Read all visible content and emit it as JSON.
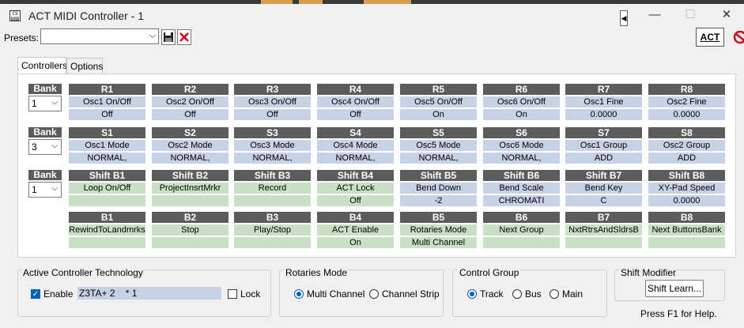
{
  "window": {
    "app_icon_text": "CS\nBBB",
    "title": "ACT MIDI Controller - 1",
    "arrow": "◀",
    "minimize": "—",
    "maximize": "☐",
    "close": "✕"
  },
  "presets": {
    "label": "Presets:",
    "value": "",
    "chevron": "⌵",
    "save_icon": "floppy-disk-icon",
    "delete_icon": "red-x-icon",
    "act_label": "ACT"
  },
  "tabs": [
    {
      "label": "Controllers",
      "active": true
    },
    {
      "label": "Options",
      "active": false
    }
  ],
  "bank_label": "Bank",
  "rows": [
    {
      "bank": "1",
      "kind": "blue",
      "cells": [
        {
          "head": "R1",
          "name": "Osc1 On/Off",
          "value": "Off"
        },
        {
          "head": "R2",
          "name": "Osc2 On/Off",
          "value": "Off"
        },
        {
          "head": "R3",
          "name": "Osc3 On/Off",
          "value": "Off"
        },
        {
          "head": "R4",
          "name": "Osc4 On/Off",
          "value": "Off"
        },
        {
          "head": "R5",
          "name": "Osc5 On/Off",
          "value": "On"
        },
        {
          "head": "R6",
          "name": "Osc6 On/Off",
          "value": "On"
        },
        {
          "head": "R7",
          "name": "Osc1 Fine",
          "value": "0.0000"
        },
        {
          "head": "R8",
          "name": "Osc2 Fine",
          "value": "0.0000"
        }
      ]
    },
    {
      "bank": "3",
      "kind": "blue",
      "cells": [
        {
          "head": "S1",
          "name": "Osc1 Mode",
          "value": "NORMAL,"
        },
        {
          "head": "S2",
          "name": "Osc2 Mode",
          "value": "NORMAL,"
        },
        {
          "head": "S3",
          "name": "Osc3 Mode",
          "value": "NORMAL,"
        },
        {
          "head": "S4",
          "name": "Osc4 Mode",
          "value": "NORMAL,"
        },
        {
          "head": "S5",
          "name": "Osc5 Mode",
          "value": "NORMAL,"
        },
        {
          "head": "S6",
          "name": "Osc6 Mode",
          "value": "NORMAL,"
        },
        {
          "head": "S7",
          "name": "Osc1 Group",
          "value": "ADD"
        },
        {
          "head": "S8",
          "name": "Osc2 Group",
          "value": "ADD"
        }
      ]
    },
    {
      "bank": "1",
      "kind": "mixed",
      "cells": [
        {
          "head": "Shift B1",
          "name": "Loop On/Off",
          "value": "",
          "color": "green"
        },
        {
          "head": "Shift B2",
          "name": "ProjectInsrtMrkr",
          "value": "",
          "color": "green"
        },
        {
          "head": "Shift B3",
          "name": "Record",
          "value": "",
          "color": "green"
        },
        {
          "head": "Shift B4",
          "name": "ACT Lock",
          "value": "Off",
          "color": "green"
        },
        {
          "head": "Shift B5",
          "name": "Bend Down",
          "value": "-2",
          "color": "blue"
        },
        {
          "head": "Shift B6",
          "name": "Bend Scale",
          "value": "CHROMATI",
          "color": "blue"
        },
        {
          "head": "Shift B7",
          "name": "Bend Key",
          "value": "C",
          "color": "blue"
        },
        {
          "head": "Shift B8",
          "name": "XY-Pad Speed",
          "value": "0.0000",
          "color": "blue"
        }
      ]
    },
    {
      "bank": null,
      "kind": "green",
      "cells": [
        {
          "head": "B1",
          "name": "RewindToLandmrks",
          "value": ""
        },
        {
          "head": "B2",
          "name": "Stop",
          "value": ""
        },
        {
          "head": "B3",
          "name": "Play/Stop",
          "value": ""
        },
        {
          "head": "B4",
          "name": "ACT Enable",
          "value": "On"
        },
        {
          "head": "B5",
          "name": "Rotaries Mode",
          "value": "Multi Channel"
        },
        {
          "head": "B6",
          "name": "Next Group",
          "value": ""
        },
        {
          "head": "B7",
          "name": "NxtRtrsAndSldrsB",
          "value": ""
        },
        {
          "head": "B8",
          "name": "Next ButtonsBank",
          "value": ""
        }
      ]
    }
  ],
  "act_group": {
    "title": "Active Controller Technology",
    "enable_label": "Enable",
    "enable_checked": true,
    "tech_value": "Z3TA+ 2    * 1",
    "lock_label": "Lock",
    "lock_checked": false
  },
  "rotaries_group": {
    "title": "Rotaries Mode",
    "options": [
      {
        "label": "Multi Channel",
        "selected": true
      },
      {
        "label": "Channel Strip",
        "selected": false
      }
    ]
  },
  "control_group": {
    "title": "Control Group",
    "options": [
      {
        "label": "Track",
        "selected": true
      },
      {
        "label": "Bus",
        "selected": false
      },
      {
        "label": "Main",
        "selected": false
      }
    ]
  },
  "shift_group": {
    "title": "Shift Modifier",
    "button_label": "Shift Learn...",
    "help": "Press F1 for Help."
  },
  "colors": {
    "header": "#5c5c5c",
    "blue": "#c7d2e6",
    "green": "#c8e1c4",
    "accent": "#005fb8"
  }
}
